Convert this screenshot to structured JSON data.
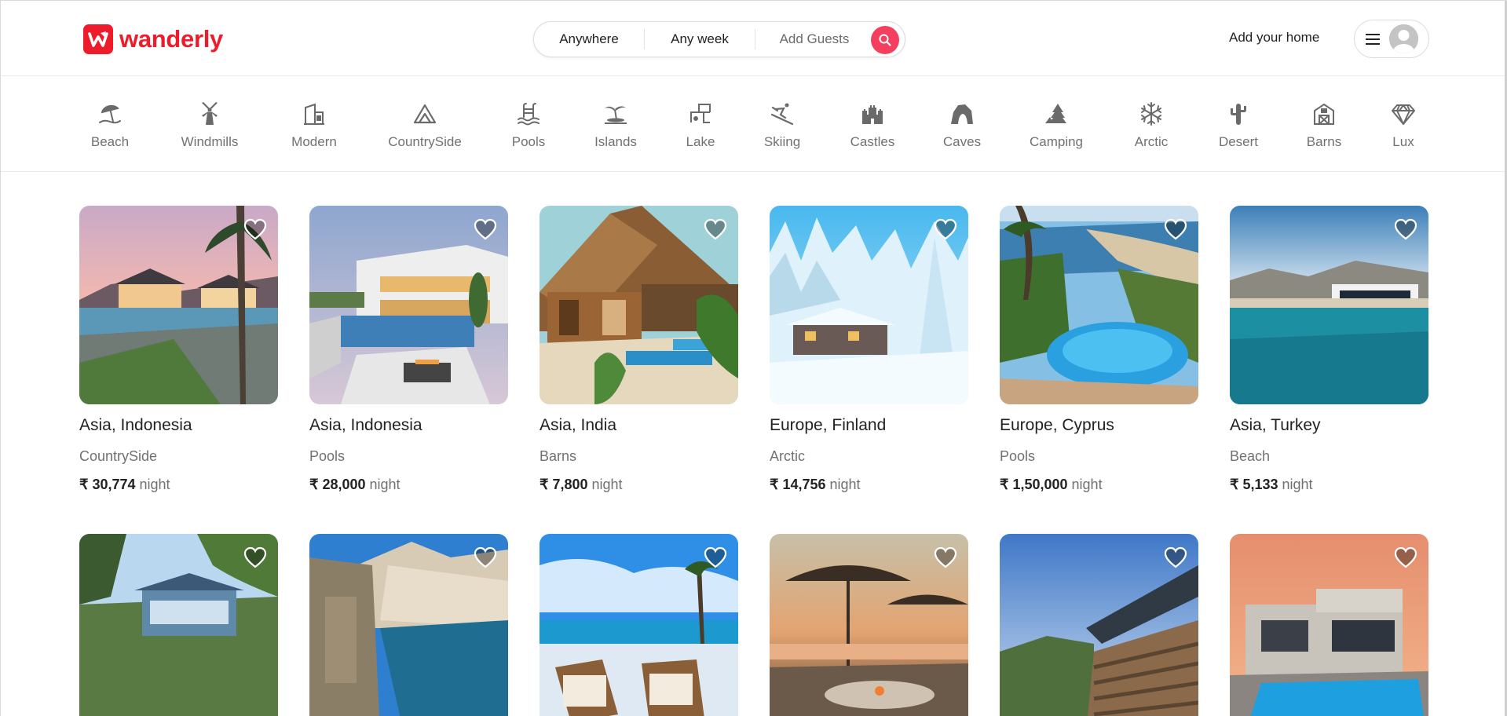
{
  "brand": {
    "name": "wanderly",
    "color": "#ee1c2b"
  },
  "search": {
    "where": "Anywhere",
    "when": "Any week",
    "guests": "Add Guests",
    "button_icon": "search-icon",
    "button_color": "#f43f5e"
  },
  "header": {
    "add_home": "Add your home",
    "menu_icon": "hamburger-icon",
    "avatar_icon": "user-avatar-icon"
  },
  "categories": [
    {
      "label": "Beach",
      "icon": "beach-umbrella-icon"
    },
    {
      "label": "Windmills",
      "icon": "windmill-icon"
    },
    {
      "label": "Modern",
      "icon": "modern-building-icon"
    },
    {
      "label": "CountrySide",
      "icon": "mountain-icon"
    },
    {
      "label": "Pools",
      "icon": "pool-ladder-icon"
    },
    {
      "label": "Islands",
      "icon": "island-icon"
    },
    {
      "label": "Lake",
      "icon": "lake-icon"
    },
    {
      "label": "Skiing",
      "icon": "skiing-icon"
    },
    {
      "label": "Castles",
      "icon": "castle-icon"
    },
    {
      "label": "Caves",
      "icon": "cave-icon"
    },
    {
      "label": "Camping",
      "icon": "tent-icon"
    },
    {
      "label": "Arctic",
      "icon": "snowflake-icon"
    },
    {
      "label": "Desert",
      "icon": "cactus-icon"
    },
    {
      "label": "Barns",
      "icon": "barn-icon"
    },
    {
      "label": "Lux",
      "icon": "diamond-icon"
    }
  ],
  "listings": [
    {
      "location": "Asia, Indonesia",
      "category": "CountrySide",
      "price": "₹ 30,774",
      "unit": "night"
    },
    {
      "location": "Asia, Indonesia",
      "category": "Pools",
      "price": "₹ 28,000",
      "unit": "night"
    },
    {
      "location": "Asia, India",
      "category": "Barns",
      "price": "₹ 7,800",
      "unit": "night"
    },
    {
      "location": "Europe, Finland",
      "category": "Arctic",
      "price": "₹ 14,756",
      "unit": "night"
    },
    {
      "location": "Europe, Cyprus",
      "category": "Pools",
      "price": "₹ 1,50,000",
      "unit": "night"
    },
    {
      "location": "Asia, Turkey",
      "category": "Beach",
      "price": "₹ 5,133",
      "unit": "night"
    },
    {
      "location": "",
      "category": "",
      "price": "",
      "unit": ""
    },
    {
      "location": "",
      "category": "",
      "price": "",
      "unit": ""
    },
    {
      "location": "",
      "category": "",
      "price": "",
      "unit": ""
    },
    {
      "location": "",
      "category": "",
      "price": "",
      "unit": ""
    },
    {
      "location": "",
      "category": "",
      "price": "",
      "unit": ""
    },
    {
      "location": "",
      "category": "",
      "price": "",
      "unit": ""
    }
  ]
}
